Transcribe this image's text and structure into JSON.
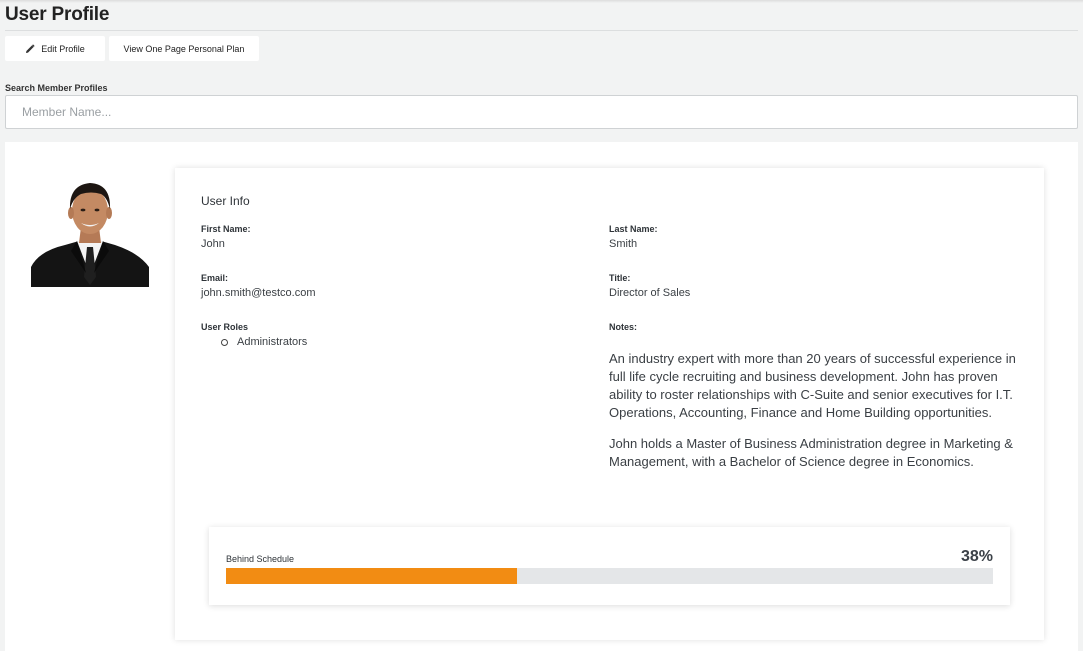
{
  "page": {
    "title": "User Profile"
  },
  "toolbar": {
    "edit_label": "Edit Profile",
    "plan_label": "View One Page Personal Plan"
  },
  "search": {
    "label": "Search Member Profiles",
    "placeholder": "Member Name...",
    "value": ""
  },
  "user_info": {
    "heading": "User Info",
    "first_name_label": "First Name:",
    "first_name": "John",
    "last_name_label": "Last Name:",
    "last_name": "Smith",
    "email_label": "Email:",
    "email": "john.smith@testco.com",
    "title_label": "Title:",
    "title": "Director of Sales",
    "roles_label": "User Roles",
    "roles": [
      "Administrators"
    ],
    "notes_label": "Notes:",
    "notes": [
      "An industry expert with more than 20 years of successful experience in full life cycle recruiting and business development. John has proven ability to roster relationships with C-Suite and senior executives for I.T. Operations, Accounting, Finance and Home Building opportunities.",
      "John holds a Master of Business Administration degree in Marketing & Management, with a Bachelor of Science degree in Economics."
    ]
  },
  "progress": {
    "label": "Behind Schedule",
    "percent_text": "38%",
    "value": 0.38,
    "fill_color": "#f28c13"
  },
  "icons": {
    "edit": "pencil-icon",
    "avatar": "user-photo"
  }
}
